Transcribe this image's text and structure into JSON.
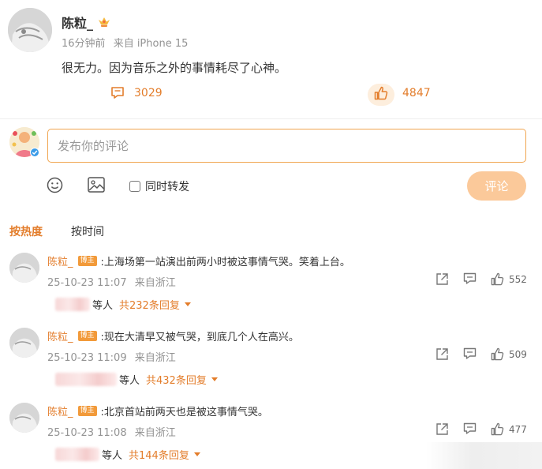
{
  "post": {
    "author": "陈粒_",
    "time": "16分钟前",
    "source": "来自 iPhone 15",
    "text": "很无力。因为音乐之外的事情耗尽了心神。",
    "comments_count": "3029",
    "likes_count": "4847"
  },
  "composer": {
    "placeholder": "发布你的评论",
    "repost_label": "同时转发",
    "submit_label": "评论"
  },
  "sort": {
    "hot_label": "按热度",
    "time_label": "按时间"
  },
  "comments": [
    {
      "author": "陈粒_",
      "badge": "博主",
      "text": ":上海场第一站演出前两小时被这事情气哭。笑着上台。",
      "time": "25-10-23 11:07",
      "location": "来自浙江",
      "likes": "552",
      "reply_suffix": "等人",
      "reply_count": "共232条回复"
    },
    {
      "author": "陈粒_",
      "badge": "博主",
      "text": ":现在大清早又被气哭，到底几个人在高兴。",
      "time": "25-10-23 11:09",
      "location": "来自浙江",
      "likes": "509",
      "reply_suffix": "等人",
      "reply_count": "共432条回复"
    },
    {
      "author": "陈粒_",
      "badge": "博主",
      "text": ":北京首站前两天也是被这事情气哭。",
      "time": "25-10-23 11:08",
      "location": "来自浙江",
      "likes": "477",
      "reply_suffix": "等人",
      "reply_count": "共144条回复"
    }
  ],
  "icons": {
    "comment": "comment-icon",
    "like": "thumbs-up-icon",
    "emoji": "emoji-icon",
    "image": "image-icon",
    "share": "share-icon",
    "reply": "reply-icon",
    "crown": "crown-icon",
    "verified": "verified-icon"
  },
  "colors": {
    "accent": "#e37d2b",
    "submit_bg": "#fbc99a",
    "input_border": "#f0a550",
    "meta_gray": "#939393"
  }
}
